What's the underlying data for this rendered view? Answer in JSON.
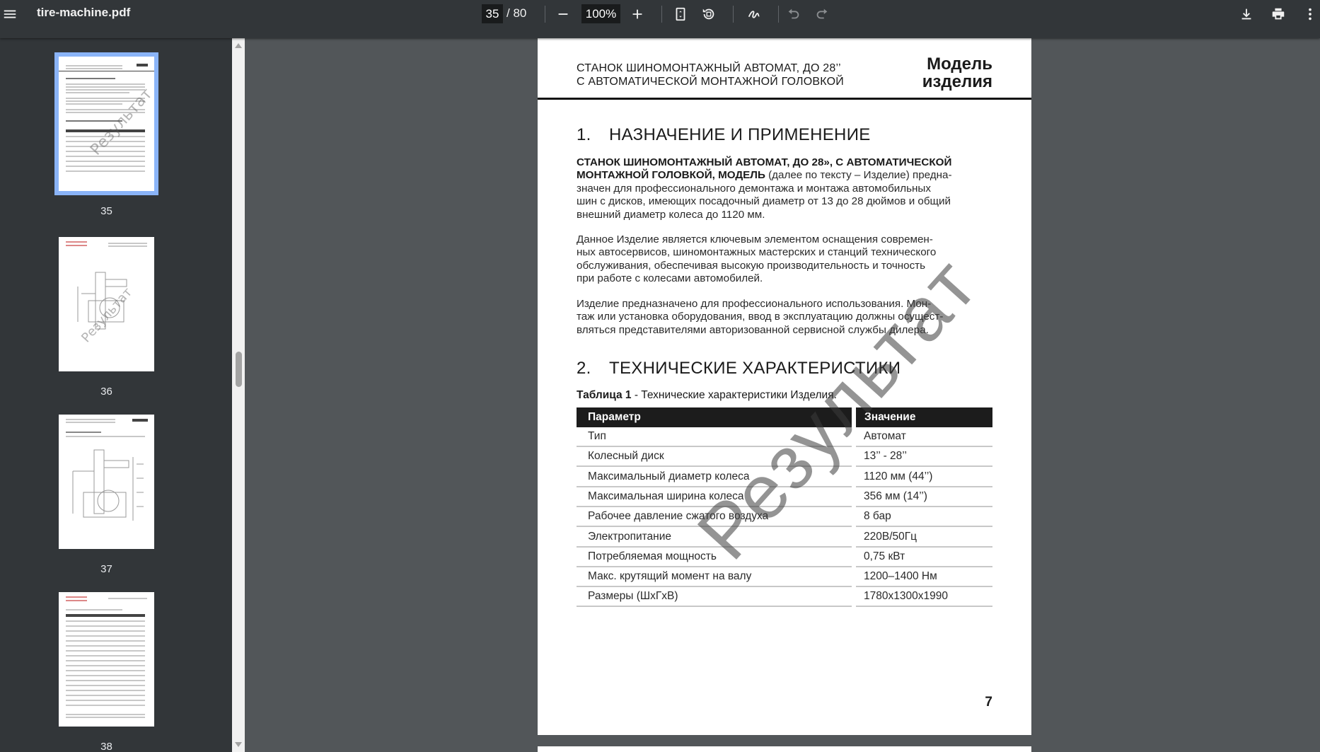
{
  "toolbar": {
    "file_name": "tire-machine.pdf",
    "current_page": "35",
    "total_pages": "/ 80",
    "zoom": "100%"
  },
  "icons": [
    "menu-icon",
    "zoom-out-icon",
    "zoom-in-icon",
    "fit-page-icon",
    "rotate-icon",
    "annotate-icon",
    "undo-icon",
    "redo-icon",
    "download-icon",
    "print-icon",
    "more-icon"
  ],
  "thumbnails": [
    {
      "label": "35"
    },
    {
      "label": "36"
    },
    {
      "label": "37"
    },
    {
      "label": "38"
    }
  ],
  "page": {
    "header_left_1": "СТАНОК ШИНОМОНТАЖНЫЙ АВТОМАТ, ДО 28’’",
    "header_left_2": "С АВТОМАТИЧЕСКОЙ МОНТАЖНОЙ ГОЛОВКОЙ",
    "header_right_1": "Модель",
    "header_right_2": "изделия",
    "section1_num": "1.",
    "section1_title": "НАЗНАЧЕНИЕ И ПРИМЕНЕНИЕ",
    "p1_line1_bold": "СТАНОК ШИНОМОНТАЖНЫЙ АВТОМАТ, ДО 28», С АВТОМАТИЧЕСКОЙ",
    "p1_line2_bold": "МОНТАЖНОЙ ГОЛОВКОЙ, МОДЕЛЬ",
    "p1_line2_rest": " (далее по тексту – Изделие) предна-",
    "p1_line3": "значен для профессионального демонтажа и монтажа автомобильных",
    "p1_line4": "шин с дисков, имеющих посадочный диаметр от 13 до 28 дюймов и общий",
    "p1_line5": "внешний диаметр колеса до 1120 мм.",
    "p2_line1": "Данное Изделие является ключевым элементом оснащения современ-",
    "p2_line2": "ных автосервисов, шиномонтажных мастерских и станций технического",
    "p2_line3": "обслуживания, обеспечивая высокую производительность и точность",
    "p2_line4": "при работе с колесами автомобилей.",
    "p3_line1": "Изделие предназначено для профессионального использования. Мон-",
    "p3_line2": "таж или установка оборудования, ввод в эксплуатацию должны осущест-",
    "p3_line3": "вляться представителями авторизованной сервисной службы дилера.",
    "section2_num": "2.",
    "section2_title": "ТЕХНИЧЕСКИЕ ХАРАКТЕРИСТИКИ",
    "caption_bold": "Таблица 1",
    "caption_rest": " - Технические характеристики Изделия.",
    "table_headers": [
      "Параметр",
      "Значение"
    ],
    "table_rows": [
      [
        "Тип",
        "Автомат"
      ],
      [
        "Колесный диск",
        "13’’ - 28’’"
      ],
      [
        "Максимальный диаметр колеса",
        "1120 мм (44’’)"
      ],
      [
        "Максимальная ширина колеса",
        "356 мм (14’’)"
      ],
      [
        "Рабочее давление сжатого воздуха",
        "8 бар"
      ],
      [
        "Электропитание",
        "220В/50Гц"
      ],
      [
        "Потребляемая мощность",
        "0,75 кВт"
      ],
      [
        "Макс. крутящий момент на валу",
        "1200–1400 Нм"
      ],
      [
        "Размеры (ШхГхВ)",
        "1780х1300х1990"
      ]
    ],
    "page_number": "7",
    "watermark": "Результат"
  }
}
